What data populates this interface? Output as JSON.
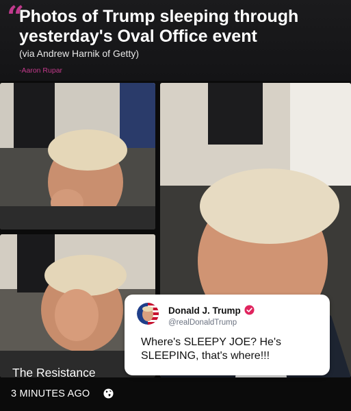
{
  "post": {
    "headline": "Photos of Trump sleeping through yesterday's Oval Office event",
    "credit": "(via Andrew Harnik of Getty)",
    "author": "-Aaron Rupar",
    "accent_color": "#c43a8c"
  },
  "photos": [
    {
      "name": "photo-top-left"
    },
    {
      "name": "photo-right-large"
    },
    {
      "name": "photo-bottom-left"
    }
  ],
  "tweet": {
    "display_name": "Donald J. Trump",
    "handle": "@realDonaldTrump",
    "text": "Where's SLEEPY JOE? He's SLEEPING, that's where!!!",
    "verified_color": "#e0245e"
  },
  "watermark": "The Resistance",
  "footer": {
    "timestamp": "3 MINUTES AGO",
    "privacy_icon": "globe-icon"
  }
}
